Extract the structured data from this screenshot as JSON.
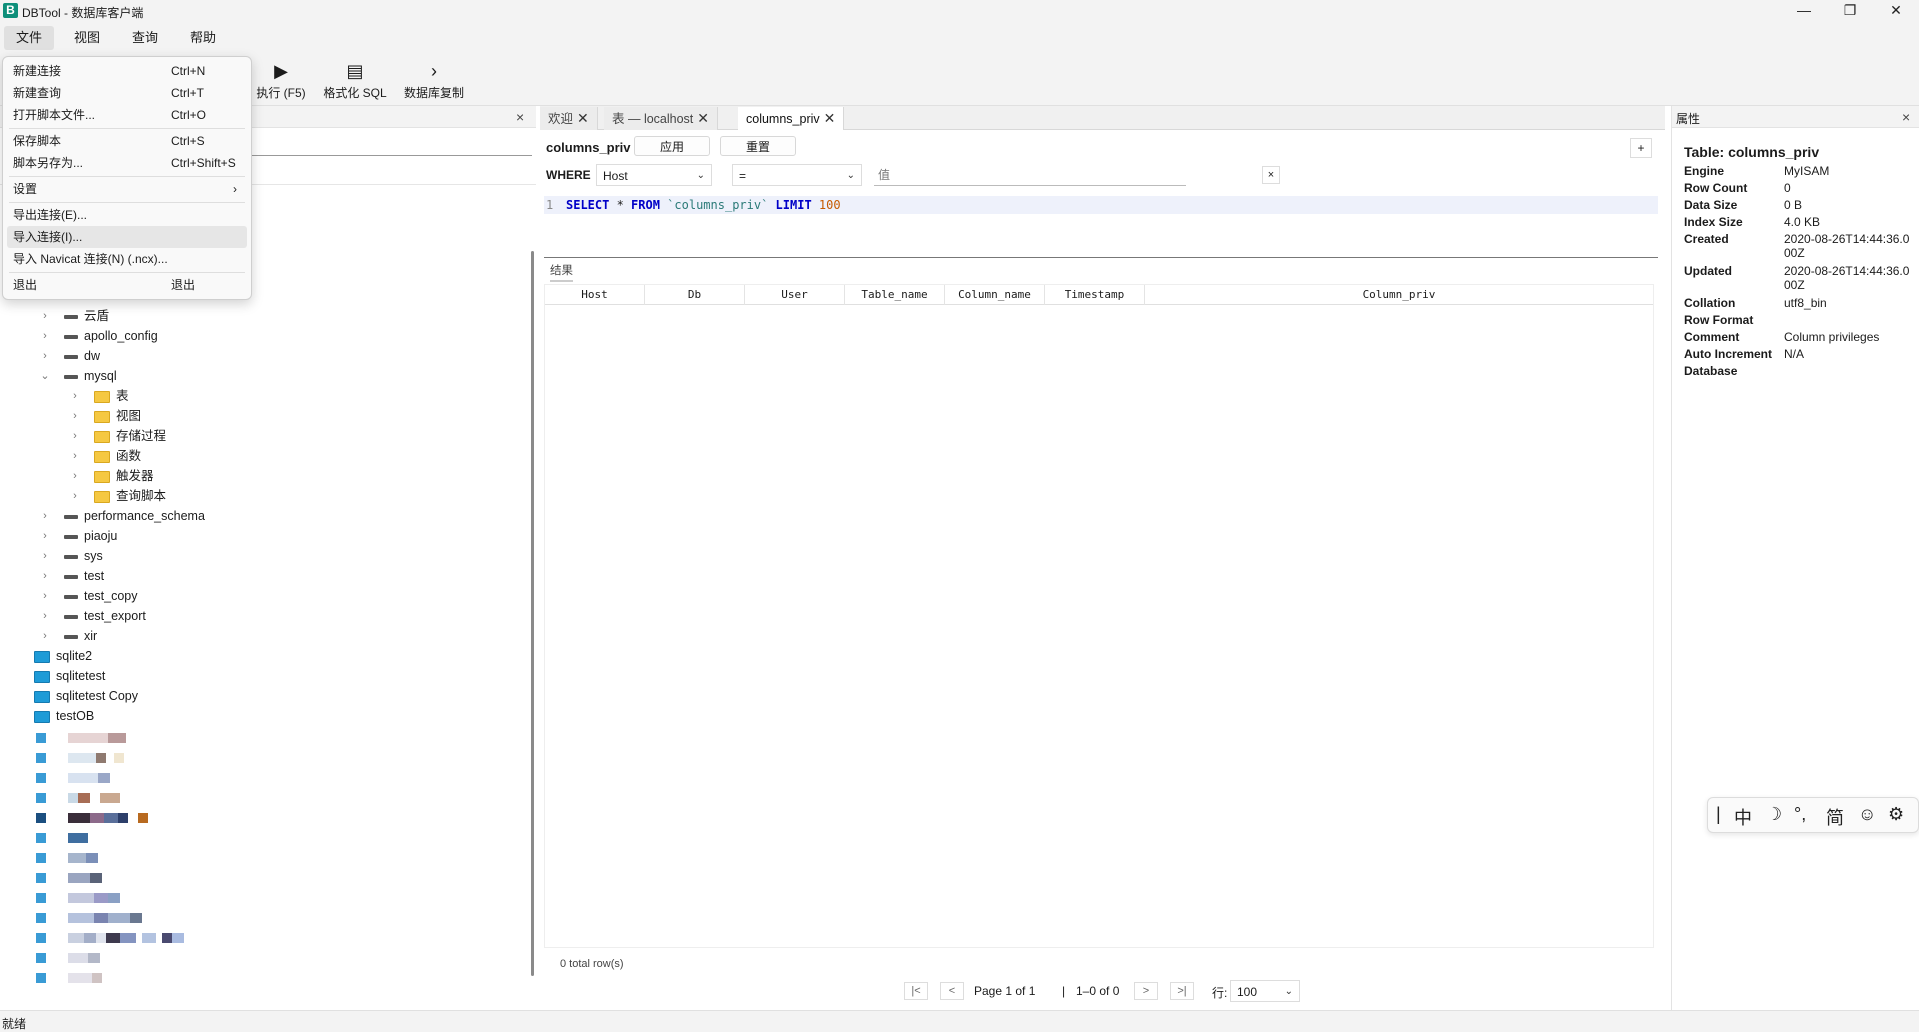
{
  "window": {
    "title": "DBTool - 数据库客户端",
    "logo": "B"
  },
  "menubar": {
    "items": [
      "文件",
      "视图",
      "查询",
      "帮助"
    ]
  },
  "toolbar": {
    "execute": "执行 (F5)",
    "format": "格式化 SQL",
    "copy_db": "数据库复制"
  },
  "file_menu": [
    {
      "label": "新建连接",
      "shortcut": "Ctrl+N"
    },
    {
      "label": "新建查询",
      "shortcut": "Ctrl+T"
    },
    {
      "label": "打开脚本文件...",
      "shortcut": "Ctrl+O"
    },
    {
      "label": "保存脚本",
      "shortcut": "Ctrl+S"
    },
    {
      "label": "脚本另存为...",
      "shortcut": "Ctrl+Shift+S"
    },
    {
      "label": "设置",
      "shortcut": "›"
    },
    {
      "label": "导出连接(E)...",
      "shortcut": ""
    },
    {
      "label": "导入连接(I)...",
      "shortcut": ""
    },
    {
      "label": "导入 Navicat 连接(N) (.ncx)...",
      "shortcut": ""
    },
    {
      "label": "退出",
      "shortcut": "退出"
    }
  ],
  "tree": {
    "databases": [
      "云盾",
      "apollo_config",
      "dw",
      "mysql"
    ],
    "mysql_folders": [
      "表",
      "视图",
      "存储过程",
      "函数",
      "触发器",
      "查询脚本"
    ],
    "databases_after": [
      "performance_schema",
      "piaoju",
      "sys",
      "test",
      "test_copy",
      "test_export",
      "xir"
    ],
    "connections": [
      "sqlite2",
      "sqlitetest",
      "sqlitetest Copy",
      "testOB"
    ]
  },
  "tabs": [
    {
      "label": "欢迎"
    },
    {
      "label": "表 — localhost"
    },
    {
      "label": "columns_priv"
    }
  ],
  "table_view": {
    "name": "columns_priv",
    "apply": "应用",
    "reset": "重置",
    "where": "WHERE",
    "column": "Host",
    "operator": "=",
    "value_placeholder": "值",
    "clear": "×",
    "add": "+",
    "line_no": "1",
    "sql": {
      "select": "SELECT",
      "star": " * ",
      "from": "FROM",
      "table": " `columns_priv` ",
      "limit": "LIMIT",
      "limit_value": " 100"
    },
    "result_tab": "结果",
    "columns": [
      "Host",
      "Db",
      "User",
      "Table_name",
      "Column_name",
      "Timestamp",
      "Column_priv"
    ],
    "row_count": "0 total row(s)",
    "pager": {
      "first": "|<",
      "prev": "<",
      "page": "Page 1 of 1",
      "sep": "|",
      "range": "1–0 of 0",
      "next": ">",
      "last": ">|",
      "rows_label": "行:",
      "rows_value": "100"
    }
  },
  "properties": {
    "header": "属性",
    "title": "Table: columns_priv",
    "rows": [
      {
        "k": "Engine",
        "v": "MyISAM"
      },
      {
        "k": "Row Count",
        "v": "0"
      },
      {
        "k": "Data Size",
        "v": "0 B"
      },
      {
        "k": "Index Size",
        "v": "4.0 KB"
      },
      {
        "k": "Created",
        "v": "2020-08-26T14:44:36.000Z"
      },
      {
        "k": "Updated",
        "v": "2020-08-26T14:44:36.000Z"
      },
      {
        "k": "Collation",
        "v": "utf8_bin"
      },
      {
        "k": "Row Format",
        "v": ""
      },
      {
        "k": "Comment",
        "v": "Column privileges"
      },
      {
        "k": "Auto Increment",
        "v": "N/A"
      },
      {
        "k": "Database",
        "v": ""
      }
    ]
  },
  "ime": [
    "|",
    "中",
    "☽",
    "°,",
    "简",
    "☺",
    "⚙"
  ],
  "status": "就绪"
}
